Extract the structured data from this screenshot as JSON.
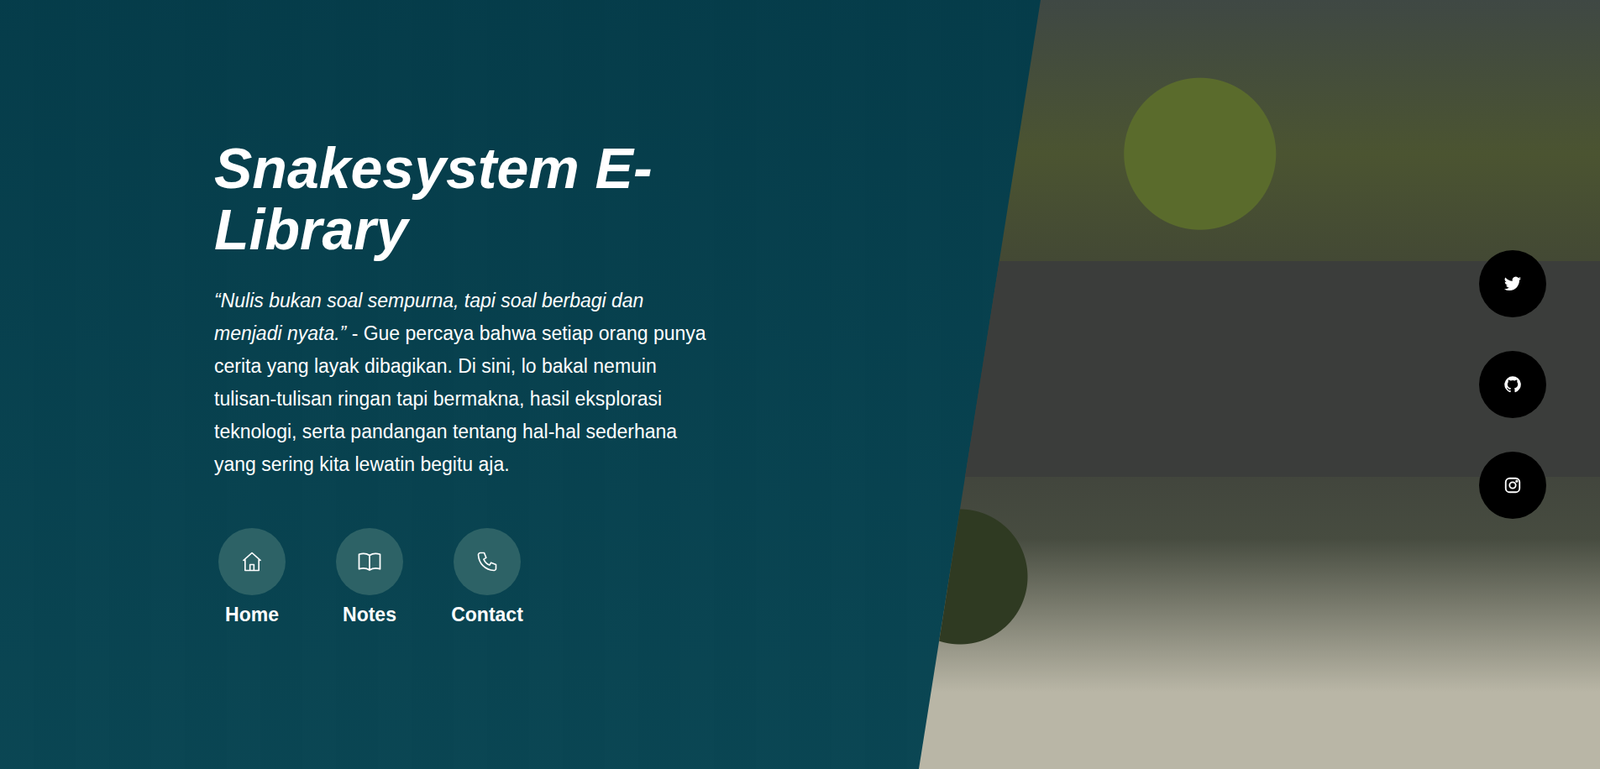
{
  "hero": {
    "title": "Snakesystem E-Library",
    "quote": "“Nulis bukan soal sempurna, tapi soal berbagi dan menjadi nyata.”",
    "text": " - Gue percaya bahwa setiap orang punya cerita yang layak dibagikan. Di sini, lo bakal nemuin tulisan-tulisan ringan tapi bermakna, hasil eksplorasi teknologi, serta pandangan tentang hal-hal sederhana yang sering kita lewatin begitu aja."
  },
  "nav": [
    {
      "label": "Home",
      "kind": "home"
    },
    {
      "label": "Notes",
      "kind": "book"
    },
    {
      "label": "Contact",
      "kind": "phone"
    }
  ],
  "social": [
    {
      "kind": "twitter"
    },
    {
      "kind": "github"
    },
    {
      "kind": "instagram"
    }
  ]
}
